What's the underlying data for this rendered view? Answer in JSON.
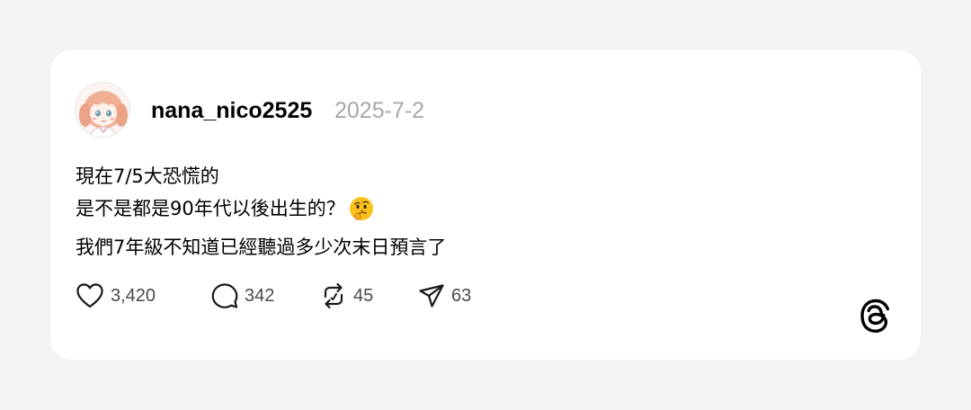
{
  "post": {
    "username": "nana_nico2525",
    "date": "2025-7-2",
    "lines": [
      "現在7/5大恐慌的",
      "是不是都是90年代以後出生的？",
      "我們7年級不知道已經聽過多少次末日預言了"
    ],
    "emoji_icon": "thinking-face-emoji"
  },
  "actions": {
    "likes": "3,420",
    "comments": "342",
    "reposts": "45",
    "shares": "63"
  },
  "icons": {
    "like": "heart-icon",
    "comment": "comment-bubble-icon",
    "repost": "repost-icon",
    "share": "send-icon",
    "brand": "threads-logo-icon"
  },
  "colors": {
    "background": "#f3f3f3",
    "card": "#ffffff",
    "text": "#000000",
    "muted": "#a8a8a8",
    "count": "#4a4a4a"
  }
}
